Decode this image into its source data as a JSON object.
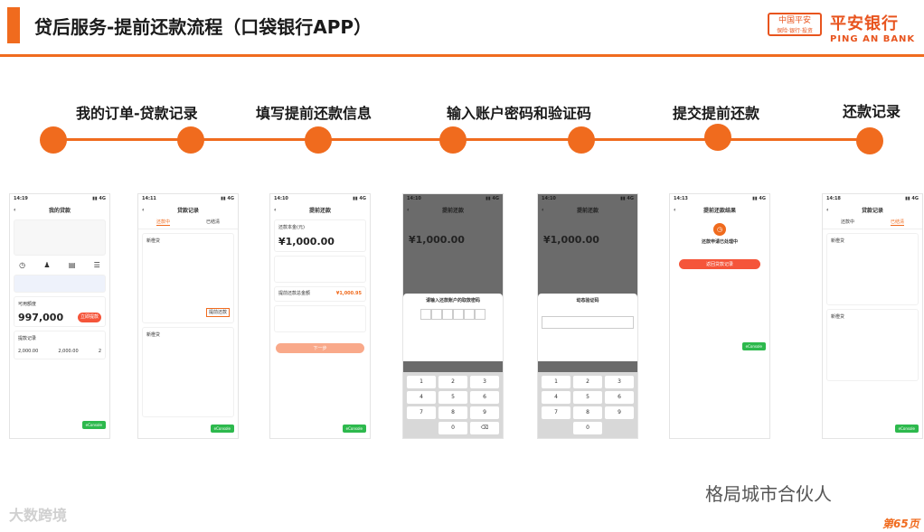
{
  "header": {
    "title": "贷后服务-提前还款流程（口袋银行APP）",
    "logo_top": "中国平安",
    "logo_sub": "保险·银行·投资",
    "bank_cn": "平安银行",
    "bank_en": "PING AN BANK"
  },
  "steps": [
    {
      "label": "我的订单-贷款记录"
    },
    {
      "label": "填写提前还款信息"
    },
    {
      "label": "输入账户密码和验证码"
    },
    {
      "label": "提交提前还款"
    },
    {
      "label": "还款记录"
    }
  ],
  "phones": {
    "p1": {
      "time": "14:19",
      "title": "我的贷款",
      "amount": "997,000",
      "credit_label": "可用额度",
      "apply_btn": "立即提款",
      "history": "提款记录",
      "val1": "2,000.00",
      "val2": "2,000.00",
      "val3": "2"
    },
    "p2": {
      "time": "14:11",
      "title": "贷款记录",
      "tab1": "还款中",
      "tab2": "已结清",
      "item": "新橙贷",
      "action": "提前还款"
    },
    "p3": {
      "time": "14:10",
      "title": "提前还款",
      "principal_label": "还款本金(元)",
      "principal": "¥1,000.00",
      "total_label": "提前还款总金额",
      "total": "¥1,000.95",
      "btn": "下一步"
    },
    "p4": {
      "time": "14:10",
      "title": "提前还款",
      "principal": "¥1,000.00",
      "modal_title": "请输入还款账户的取款密码"
    },
    "p5": {
      "time": "14:10",
      "title": "提前还款",
      "principal": "¥1,000.00",
      "modal_title": "动态验证码"
    },
    "p6": {
      "time": "14:13",
      "title": "提前还款结果",
      "status": "还款申请已处理中",
      "btn": "返回贷款记录"
    },
    "p7": {
      "time": "14:18",
      "title": "贷款记录",
      "tab1": "还款中",
      "tab2": "已结清",
      "item": "新橙贷"
    }
  },
  "keypad": [
    "1",
    "2",
    "3",
    "4",
    "5",
    "6",
    "7",
    "8",
    "9",
    "",
    "0",
    "⌫"
  ],
  "green_btn": "eConsole",
  "watermark_left": "大数跨境",
  "watermark_right": "格局城市合伙人",
  "page_number": "第65页"
}
